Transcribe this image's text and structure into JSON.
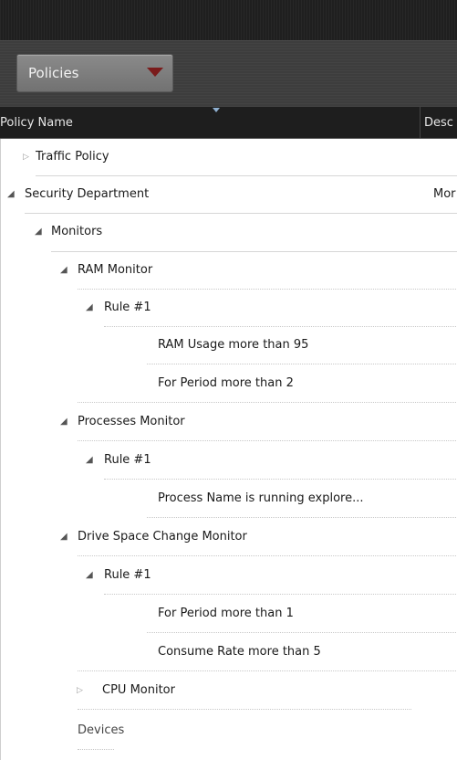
{
  "toolbar": {
    "dropdown_value": "Policies"
  },
  "grid": {
    "columns": {
      "name": "Policy Name",
      "description": "Desc"
    },
    "rows": {
      "traffic_policy": "Traffic Policy",
      "security_department": "Security Department",
      "security_department_desc": "Mor",
      "monitors": "Monitors",
      "ram_monitor": "RAM  Monitor",
      "ram_rule": "Rule #1",
      "ram_cond1": "RAM Usage more than 95",
      "ram_cond2": "For Period more than 2",
      "processes_monitor": "Processes Monitor",
      "processes_rule": "Rule #1",
      "processes_cond1": "Process Name is running explore...",
      "drive_monitor": "Drive Space Change Monitor",
      "drive_rule": "Rule #1",
      "drive_cond1": "For Period more than 1",
      "drive_cond2": "Consume Rate more than 5",
      "cpu_monitor": "CPU Monitor",
      "devices": "Devices"
    }
  },
  "icons": {
    "expanded": "triangle-expanded-icon",
    "collapsed": "triangle-collapsed-icon",
    "dropdown": "dropdown-arrow-icon"
  },
  "colors": {
    "toolbar_bg": "#3d3d3d",
    "header_bg": "#1e1e1e",
    "dropdown_arrow": "#7a1b1b"
  }
}
